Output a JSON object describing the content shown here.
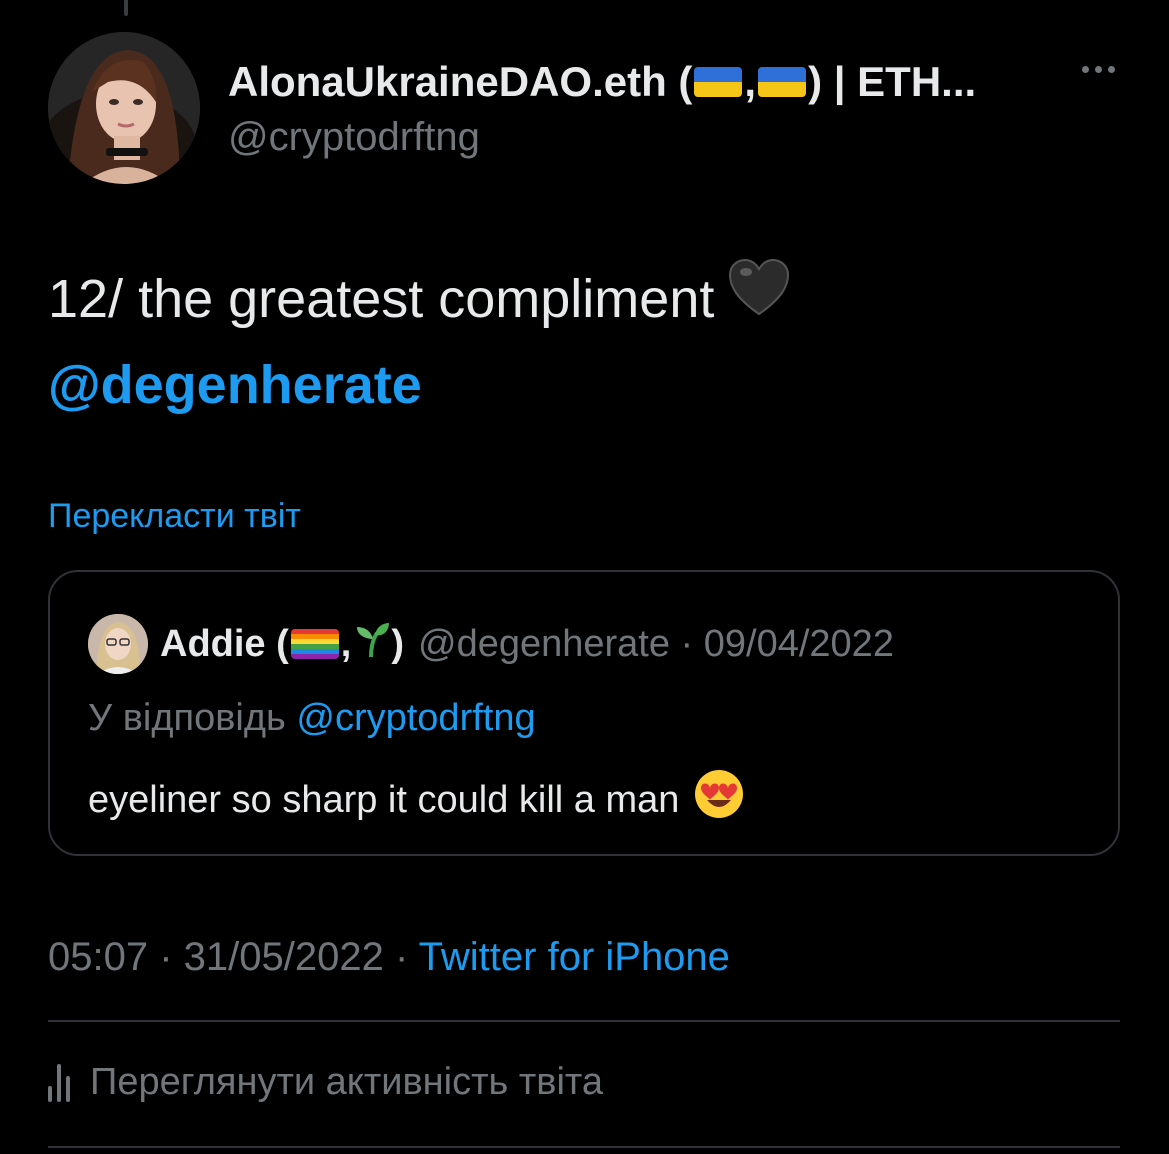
{
  "author": {
    "display_name_start": "AlonaUkraineDAO.eth (",
    "display_name_comma": ",",
    "display_name_end": ") | ETH...",
    "handle": "@cryptodrftng"
  },
  "tweet": {
    "text": "12/ the greatest compliment",
    "mention": "@degenherate",
    "translate_label": "Перекласти твіт"
  },
  "quoted": {
    "name_start": "Addie (",
    "name_comma": ",",
    "name_end": ")",
    "handle_date": "@degenherate · 09/04/2022",
    "reply_prefix": "У відповідь",
    "reply_to": "@cryptodrftng",
    "text": "eyeliner so sharp it could kill a man"
  },
  "meta": {
    "time_date": "05:07 · 31/05/2022 · ",
    "source": "Twitter for iPhone"
  },
  "activity_label": "Переглянути активність твіта",
  "icons": {
    "more": "more-icon",
    "flags": "ukraine-flag-icon",
    "heart": "black-heart-icon",
    "rainbow": "rainbow-flag-icon",
    "seedling": "seedling-icon",
    "face": "heart-eyes-icon",
    "activity": "analytics-icon"
  },
  "colors": {
    "background": "#000000",
    "text": "#e7e9ea",
    "secondary": "#71767b",
    "accent": "#1d9bf0",
    "border": "#2f3336"
  }
}
